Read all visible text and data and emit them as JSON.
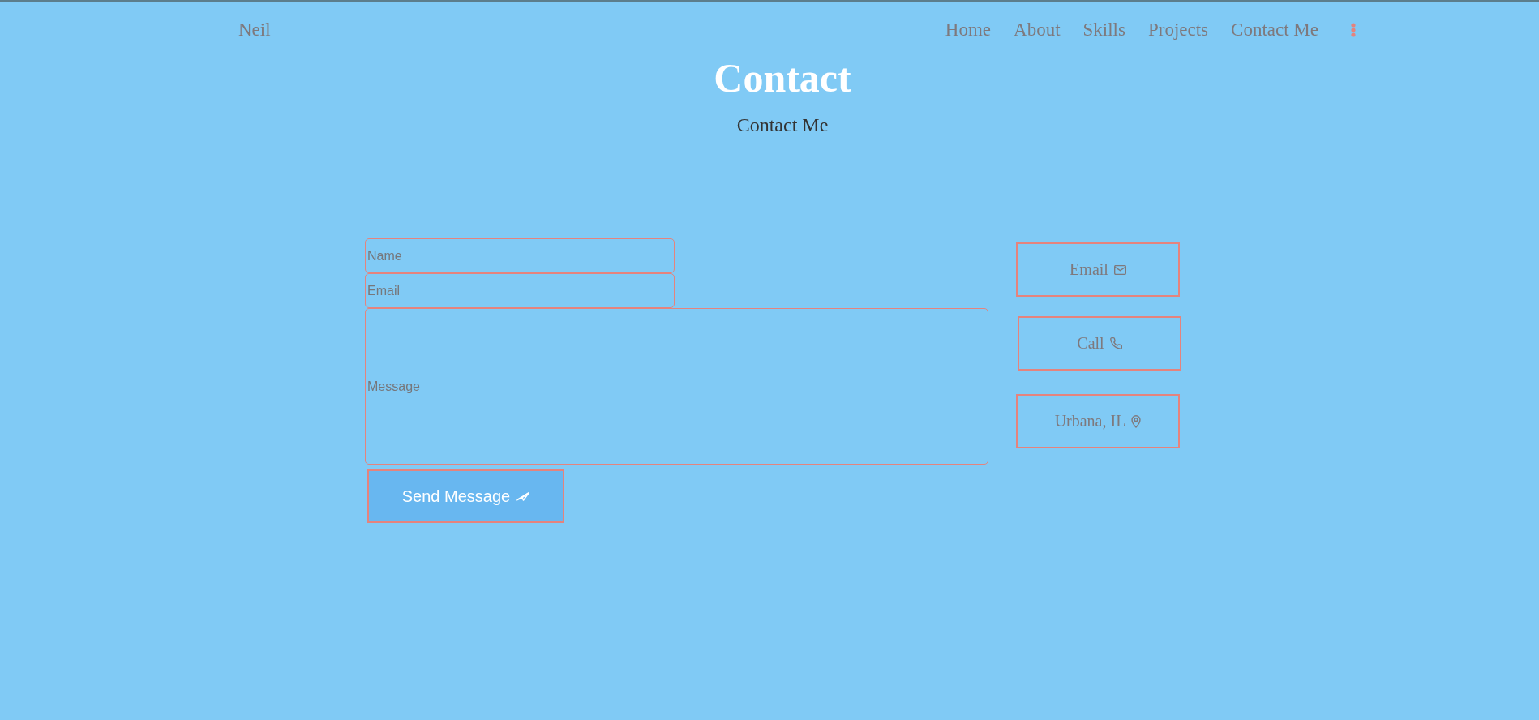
{
  "nav": {
    "brand": "Neil",
    "links": [
      "Home",
      "About",
      "Skills",
      "Projects",
      "Contact Me"
    ]
  },
  "header": {
    "title": "Contact",
    "subtitle": "Contact Me"
  },
  "form": {
    "fields": [
      {
        "kind": "input",
        "placeholder": "Name"
      },
      {
        "kind": "input",
        "placeholder": "Email"
      },
      {
        "kind": "message",
        "placeholder": "Message"
      }
    ],
    "submit": {
      "label": "Send Message"
    }
  },
  "contacts": [
    {
      "kind": "email",
      "label": "Email"
    },
    {
      "kind": "phone",
      "label": "Call"
    },
    {
      "kind": "location",
      "label": "Urbana, IL"
    }
  ]
}
